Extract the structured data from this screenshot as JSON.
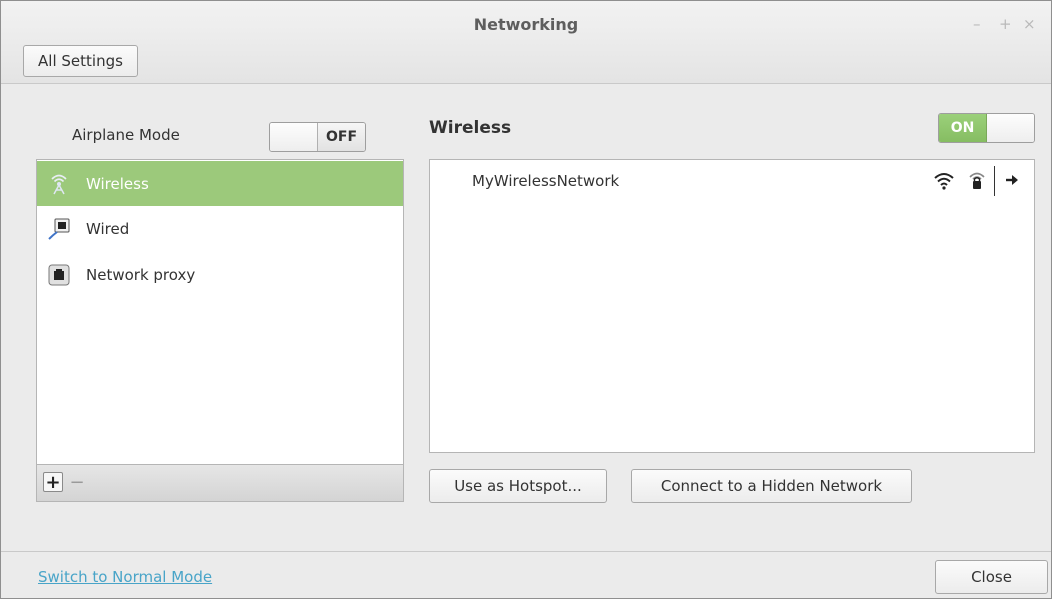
{
  "window": {
    "title": "Networking"
  },
  "header": {
    "all_settings_label": "All Settings"
  },
  "airplane": {
    "label": "Airplane Mode",
    "state": "OFF"
  },
  "sidebar": {
    "items": [
      {
        "label": "Wireless",
        "icon": "wireless-icon",
        "selected": true
      },
      {
        "label": "Wired",
        "icon": "wired-icon",
        "selected": false
      },
      {
        "label": "Network proxy",
        "icon": "proxy-icon",
        "selected": false
      }
    ],
    "add_label": "+",
    "remove_label": "−"
  },
  "wireless": {
    "heading": "Wireless",
    "state": "ON",
    "networks": [
      {
        "name": "MyWirelessNetwork",
        "signal_icon": "wifi-signal-icon",
        "lock_icon": "lock-icon",
        "arrow_icon": "arrow-right-icon"
      }
    ],
    "hotspot_label": "Use as Hotspot...",
    "hidden_label": "Connect to a Hidden Network"
  },
  "footer": {
    "mode_link": "Switch to Normal Mode",
    "close_label": "Close"
  },
  "colors": {
    "selection": "#9cc97b",
    "link": "#48a4c8",
    "switch_on": "#8dc26a"
  }
}
